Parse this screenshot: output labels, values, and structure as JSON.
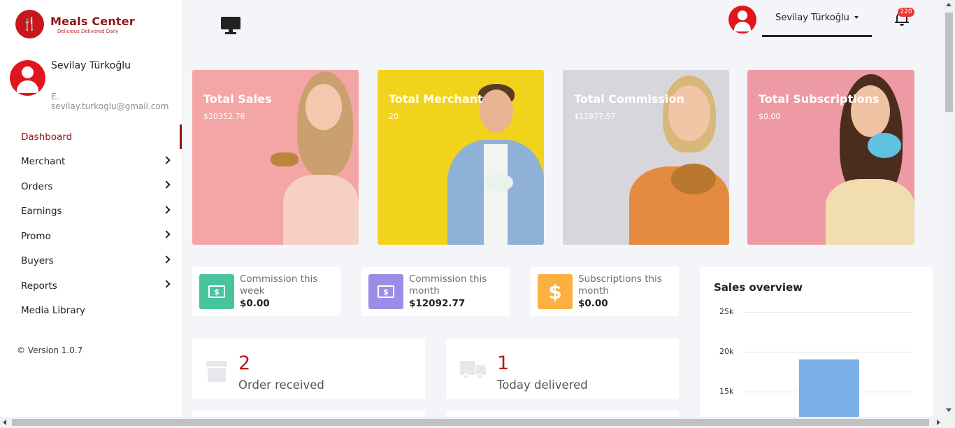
{
  "brand": {
    "name": "Meals Center",
    "tagline": "Delicious Delivered Daily",
    "color": "#8e1316"
  },
  "sidebar": {
    "profile": {
      "name": "Sevilay Türkoğlu",
      "email": "E. sevilay.turkoglu@gmail.com"
    },
    "items": [
      {
        "label": "Dashboard",
        "active": true,
        "has_chevron": false
      },
      {
        "label": "Merchant",
        "has_chevron": true
      },
      {
        "label": "Orders",
        "has_chevron": true
      },
      {
        "label": "Earnings",
        "has_chevron": true
      },
      {
        "label": "Promo",
        "has_chevron": true
      },
      {
        "label": "Buyers",
        "has_chevron": true
      },
      {
        "label": "Reports",
        "has_chevron": true
      },
      {
        "label": "Media Library",
        "has_chevron": false
      }
    ],
    "version": "© Version 1.0.7"
  },
  "header": {
    "icon": "monitor-icon",
    "user_name": "Sevilay Türkoğlu",
    "notification_count": "220"
  },
  "hero_cards": [
    {
      "title": "Total Sales",
      "value": "$20352.76",
      "bg": "#f4a6a6"
    },
    {
      "title": "Total Merchant",
      "value": "20",
      "bg": "#f2d31b"
    },
    {
      "title": "Total Commission",
      "value": "$11977.57",
      "bg": "#d7d7db"
    },
    {
      "title": "Total Subscriptions",
      "value": "$0.00",
      "bg": "#ee9aa5"
    }
  ],
  "stat_cards": [
    {
      "label": "Commission this week",
      "value": "$0.00",
      "icon": "money-bill-icon",
      "color": "#47c39d"
    },
    {
      "label": "Commission this month",
      "value": "$12092.77",
      "icon": "money-bill-icon",
      "color": "#9b8de6"
    },
    {
      "label": "Subscriptions this month",
      "value": "$0.00",
      "icon": "dollar-icon",
      "color": "#fbb040"
    }
  ],
  "order_cards": [
    {
      "count": "2",
      "label": "Order received",
      "icon": "store-icon"
    },
    {
      "count": "1",
      "label": "Today delivered",
      "icon": "truck-icon"
    }
  ],
  "sales_overview": {
    "title": "Sales overview",
    "chart_data": {
      "type": "bar",
      "title": "Sales overview",
      "y_ticks": [
        "25k",
        "20k",
        "15k"
      ],
      "ylim_visible": [
        15000,
        25000
      ],
      "values": [
        19000
      ],
      "color": "#7aafe8"
    }
  }
}
